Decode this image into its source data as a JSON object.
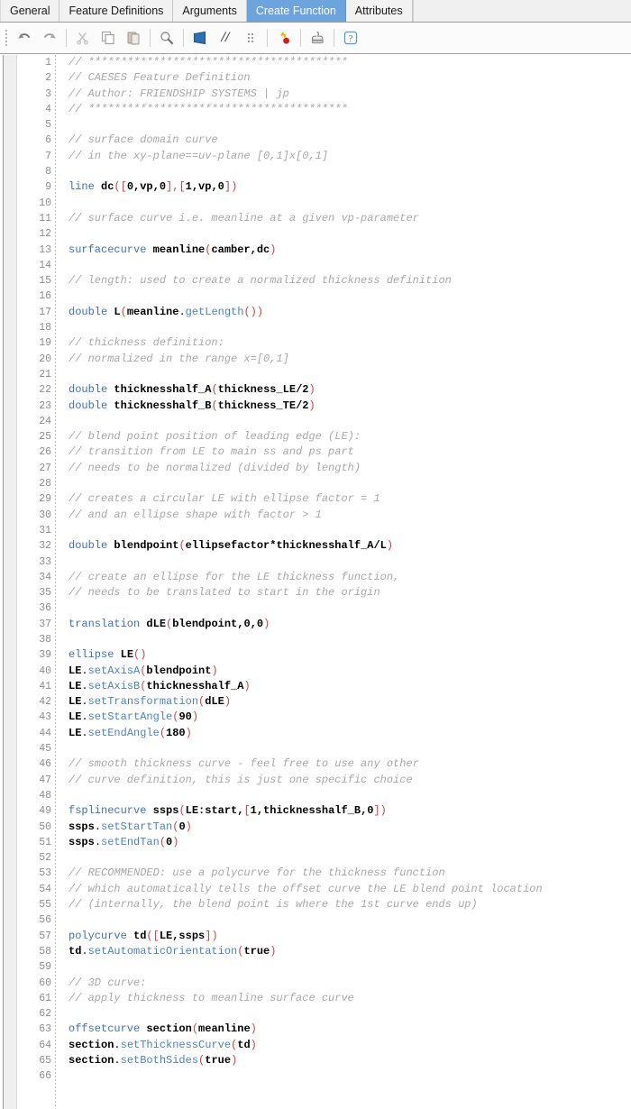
{
  "window": {
    "tabs": [
      {
        "label": "General",
        "active": false
      },
      {
        "label": "Feature Definitions",
        "active": false
      },
      {
        "label": "Arguments",
        "active": false
      },
      {
        "label": "Create Function",
        "active": true
      },
      {
        "label": "Attributes",
        "active": false
      }
    ],
    "active_tab": "Create Function"
  },
  "toolbar": {
    "buttons": [
      {
        "name": "undo-icon",
        "label": "Undo",
        "glyph": "arrow-undo"
      },
      {
        "name": "redo-icon",
        "label": "Redo",
        "glyph": "arrow-redo"
      },
      {
        "name": "cut-icon",
        "label": "Cut",
        "glyph": "scissors"
      },
      {
        "name": "copy-icon",
        "label": "Copy",
        "glyph": "copy"
      },
      {
        "name": "paste-icon",
        "label": "Paste",
        "glyph": "clipboard"
      },
      {
        "name": "find-icon",
        "label": "Find",
        "glyph": "magnifier"
      },
      {
        "name": "insert-feature-icon",
        "label": "Insert Feature",
        "glyph": "blue-flag"
      },
      {
        "name": "comment-icon",
        "label": "Comment",
        "text": "//"
      },
      {
        "name": "indent-icon",
        "label": "Format",
        "glyph": "dots"
      },
      {
        "name": "run-icon",
        "label": "Run",
        "glyph": "star-dot"
      },
      {
        "name": "stamp-icon",
        "label": "Stamp",
        "glyph": "stamp"
      },
      {
        "name": "help-icon",
        "label": "Help",
        "text": "?"
      }
    ]
  },
  "colors": {
    "accent_blue": "#6da4de",
    "keyword_blue": "#3f6fbe",
    "method_blue": "#4b82c8",
    "comment_gray": "#a8a8a8",
    "bracket_red": "#cc4444",
    "gutter_gray": "#8d8d8d",
    "star_gold": "#e8b500",
    "dot_red": "#d81b1b"
  },
  "editor": {
    "first_line": 1,
    "last_line": 66,
    "lines": [
      {
        "n": 1,
        "tokens": [
          {
            "t": "c",
            "v": "// ****************************************"
          }
        ]
      },
      {
        "n": 2,
        "tokens": [
          {
            "t": "c",
            "v": "// CAESES Feature Definition"
          }
        ]
      },
      {
        "n": 3,
        "tokens": [
          {
            "t": "c",
            "v": "// Author: FRIENDSHIP SYSTEMS | jp"
          }
        ]
      },
      {
        "n": 4,
        "tokens": [
          {
            "t": "c",
            "v": "// ****************************************"
          }
        ]
      },
      {
        "n": 5,
        "tokens": []
      },
      {
        "n": 6,
        "tokens": [
          {
            "t": "c",
            "v": "// surface domain curve"
          }
        ]
      },
      {
        "n": 7,
        "tokens": [
          {
            "t": "c",
            "v": "// in the xy-plane==uv-plane [0,1]x[0,1]"
          }
        ]
      },
      {
        "n": 8,
        "tokens": []
      },
      {
        "n": 9,
        "tokens": [
          {
            "t": "k",
            "v": "line"
          },
          {
            "t": "n",
            "v": " "
          },
          {
            "t": "id",
            "v": "dc"
          },
          {
            "t": "p",
            "v": "(["
          },
          {
            "t": "id",
            "v": "0,vp,0"
          },
          {
            "t": "p",
            "v": "],["
          },
          {
            "t": "id",
            "v": "1,vp,0"
          },
          {
            "t": "p",
            "v": "])"
          }
        ]
      },
      {
        "n": 10,
        "tokens": []
      },
      {
        "n": 11,
        "tokens": [
          {
            "t": "c",
            "v": "// surface curve i.e. meanline at a given vp-parameter"
          }
        ]
      },
      {
        "n": 12,
        "tokens": []
      },
      {
        "n": 13,
        "tokens": [
          {
            "t": "k",
            "v": "surfacecurve"
          },
          {
            "t": "n",
            "v": " "
          },
          {
            "t": "id",
            "v": "meanline"
          },
          {
            "t": "p",
            "v": "("
          },
          {
            "t": "id",
            "v": "camber,dc"
          },
          {
            "t": "p",
            "v": ")"
          }
        ]
      },
      {
        "n": 14,
        "tokens": []
      },
      {
        "n": 15,
        "tokens": [
          {
            "t": "c",
            "v": "// length: used to create a normalized thickness definition"
          }
        ]
      },
      {
        "n": 16,
        "tokens": []
      },
      {
        "n": 17,
        "tokens": [
          {
            "t": "k",
            "v": "double"
          },
          {
            "t": "n",
            "v": " "
          },
          {
            "t": "id",
            "v": "L"
          },
          {
            "t": "p",
            "v": "("
          },
          {
            "t": "id",
            "v": "meanline"
          },
          {
            "t": "n",
            "v": "."
          },
          {
            "t": "m",
            "v": "getLength"
          },
          {
            "t": "p",
            "v": "())"
          }
        ]
      },
      {
        "n": 18,
        "tokens": []
      },
      {
        "n": 19,
        "tokens": [
          {
            "t": "c",
            "v": "// thickness definition:"
          }
        ]
      },
      {
        "n": 20,
        "tokens": [
          {
            "t": "c",
            "v": "// normalized in the range x=[0,1]"
          }
        ]
      },
      {
        "n": 21,
        "tokens": []
      },
      {
        "n": 22,
        "tokens": [
          {
            "t": "k",
            "v": "double"
          },
          {
            "t": "n",
            "v": " "
          },
          {
            "t": "id",
            "v": "thicknesshalf_A"
          },
          {
            "t": "p",
            "v": "("
          },
          {
            "t": "id",
            "v": "thickness_LE/2"
          },
          {
            "t": "p",
            "v": ")"
          }
        ]
      },
      {
        "n": 23,
        "tokens": [
          {
            "t": "k",
            "v": "double"
          },
          {
            "t": "n",
            "v": " "
          },
          {
            "t": "id",
            "v": "thicknesshalf_B"
          },
          {
            "t": "p",
            "v": "("
          },
          {
            "t": "id",
            "v": "thickness_TE/2"
          },
          {
            "t": "p",
            "v": ")"
          }
        ]
      },
      {
        "n": 24,
        "tokens": []
      },
      {
        "n": 25,
        "tokens": [
          {
            "t": "c",
            "v": "// blend point position of leading edge (LE):"
          }
        ]
      },
      {
        "n": 26,
        "tokens": [
          {
            "t": "c",
            "v": "// transition from LE to main ss and ps part"
          }
        ]
      },
      {
        "n": 27,
        "tokens": [
          {
            "t": "c",
            "v": "// needs to be normalized (divided by length)"
          }
        ]
      },
      {
        "n": 28,
        "tokens": []
      },
      {
        "n": 29,
        "tokens": [
          {
            "t": "c",
            "v": "// creates a circular LE with ellipse factor = 1"
          }
        ]
      },
      {
        "n": 30,
        "tokens": [
          {
            "t": "c",
            "v": "// and an ellipse shape with factor > 1"
          }
        ]
      },
      {
        "n": 31,
        "tokens": []
      },
      {
        "n": 32,
        "tokens": [
          {
            "t": "k",
            "v": "double"
          },
          {
            "t": "n",
            "v": " "
          },
          {
            "t": "id",
            "v": "blendpoint"
          },
          {
            "t": "p",
            "v": "("
          },
          {
            "t": "id",
            "v": "ellipsefactor*thicknesshalf_A/L"
          },
          {
            "t": "p",
            "v": ")"
          }
        ]
      },
      {
        "n": 33,
        "tokens": []
      },
      {
        "n": 34,
        "tokens": [
          {
            "t": "c",
            "v": "// create an ellipse for the LE thickness function,"
          }
        ]
      },
      {
        "n": 35,
        "tokens": [
          {
            "t": "c",
            "v": "// needs to be translated to start in the origin"
          }
        ]
      },
      {
        "n": 36,
        "tokens": []
      },
      {
        "n": 37,
        "tokens": [
          {
            "t": "k",
            "v": "translation"
          },
          {
            "t": "n",
            "v": " "
          },
          {
            "t": "id",
            "v": "dLE"
          },
          {
            "t": "p",
            "v": "("
          },
          {
            "t": "id",
            "v": "blendpoint,0,0"
          },
          {
            "t": "p",
            "v": ")"
          }
        ]
      },
      {
        "n": 38,
        "tokens": []
      },
      {
        "n": 39,
        "tokens": [
          {
            "t": "k",
            "v": "ellipse"
          },
          {
            "t": "n",
            "v": " "
          },
          {
            "t": "id",
            "v": "LE"
          },
          {
            "t": "p",
            "v": "()"
          }
        ]
      },
      {
        "n": 40,
        "tokens": [
          {
            "t": "id",
            "v": "LE"
          },
          {
            "t": "n",
            "v": "."
          },
          {
            "t": "m",
            "v": "setAxisA"
          },
          {
            "t": "p",
            "v": "("
          },
          {
            "t": "id",
            "v": "blendpoint"
          },
          {
            "t": "p",
            "v": ")"
          }
        ]
      },
      {
        "n": 41,
        "tokens": [
          {
            "t": "id",
            "v": "LE"
          },
          {
            "t": "n",
            "v": "."
          },
          {
            "t": "m",
            "v": "setAxisB"
          },
          {
            "t": "p",
            "v": "("
          },
          {
            "t": "id",
            "v": "thicknesshalf_A"
          },
          {
            "t": "p",
            "v": ")"
          }
        ]
      },
      {
        "n": 42,
        "tokens": [
          {
            "t": "id",
            "v": "LE"
          },
          {
            "t": "n",
            "v": "."
          },
          {
            "t": "m",
            "v": "setTransformation"
          },
          {
            "t": "p",
            "v": "("
          },
          {
            "t": "id",
            "v": "dLE"
          },
          {
            "t": "p",
            "v": ")"
          }
        ]
      },
      {
        "n": 43,
        "tokens": [
          {
            "t": "id",
            "v": "LE"
          },
          {
            "t": "n",
            "v": "."
          },
          {
            "t": "m",
            "v": "setStartAngle"
          },
          {
            "t": "p",
            "v": "("
          },
          {
            "t": "id",
            "v": "90"
          },
          {
            "t": "p",
            "v": ")"
          }
        ]
      },
      {
        "n": 44,
        "tokens": [
          {
            "t": "id",
            "v": "LE"
          },
          {
            "t": "n",
            "v": "."
          },
          {
            "t": "m",
            "v": "setEndAngle"
          },
          {
            "t": "p",
            "v": "("
          },
          {
            "t": "id",
            "v": "180"
          },
          {
            "t": "p",
            "v": ")"
          }
        ]
      },
      {
        "n": 45,
        "tokens": []
      },
      {
        "n": 46,
        "tokens": [
          {
            "t": "c",
            "v": "// smooth thickness curve - feel free to use any other"
          }
        ]
      },
      {
        "n": 47,
        "tokens": [
          {
            "t": "c",
            "v": "// curve definition, this is just one specific choice"
          }
        ]
      },
      {
        "n": 48,
        "tokens": []
      },
      {
        "n": 49,
        "tokens": [
          {
            "t": "k",
            "v": "fsplinecurve"
          },
          {
            "t": "n",
            "v": " "
          },
          {
            "t": "id",
            "v": "ssps"
          },
          {
            "t": "p",
            "v": "("
          },
          {
            "t": "id",
            "v": "LE:start,"
          },
          {
            "t": "p",
            "v": "["
          },
          {
            "t": "id",
            "v": "1,thicknesshalf_B,0"
          },
          {
            "t": "p",
            "v": "])"
          }
        ]
      },
      {
        "n": 50,
        "tokens": [
          {
            "t": "id",
            "v": "ssps"
          },
          {
            "t": "n",
            "v": "."
          },
          {
            "t": "m",
            "v": "setStartTan"
          },
          {
            "t": "p",
            "v": "("
          },
          {
            "t": "id",
            "v": "0"
          },
          {
            "t": "p",
            "v": ")"
          }
        ]
      },
      {
        "n": 51,
        "tokens": [
          {
            "t": "id",
            "v": "ssps"
          },
          {
            "t": "n",
            "v": "."
          },
          {
            "t": "m",
            "v": "setEndTan"
          },
          {
            "t": "p",
            "v": "("
          },
          {
            "t": "id",
            "v": "0"
          },
          {
            "t": "p",
            "v": ")"
          }
        ]
      },
      {
        "n": 52,
        "tokens": []
      },
      {
        "n": 53,
        "tokens": [
          {
            "t": "c",
            "v": "// RECOMMENDED: use a polycurve for the thickness function"
          }
        ]
      },
      {
        "n": 54,
        "tokens": [
          {
            "t": "c",
            "v": "// which automatically tells the offset curve the LE blend point location"
          }
        ]
      },
      {
        "n": 55,
        "tokens": [
          {
            "t": "c",
            "v": "// (internally, the blend point is where the 1st curve ends up)"
          }
        ]
      },
      {
        "n": 56,
        "tokens": []
      },
      {
        "n": 57,
        "tokens": [
          {
            "t": "k",
            "v": "polycurve"
          },
          {
            "t": "n",
            "v": " "
          },
          {
            "t": "id",
            "v": "td"
          },
          {
            "t": "p",
            "v": "(["
          },
          {
            "t": "id",
            "v": "LE,ssps"
          },
          {
            "t": "p",
            "v": "])"
          }
        ]
      },
      {
        "n": 58,
        "tokens": [
          {
            "t": "id",
            "v": "td"
          },
          {
            "t": "n",
            "v": "."
          },
          {
            "t": "m",
            "v": "setAutomaticOrientation"
          },
          {
            "t": "p",
            "v": "("
          },
          {
            "t": "id",
            "v": "true"
          },
          {
            "t": "p",
            "v": ")"
          }
        ]
      },
      {
        "n": 59,
        "tokens": []
      },
      {
        "n": 60,
        "tokens": [
          {
            "t": "c",
            "v": "// 3D curve:"
          }
        ]
      },
      {
        "n": 61,
        "tokens": [
          {
            "t": "c",
            "v": "// apply thickness to meanline surface curve"
          }
        ]
      },
      {
        "n": 62,
        "tokens": []
      },
      {
        "n": 63,
        "tokens": [
          {
            "t": "k",
            "v": "offsetcurve"
          },
          {
            "t": "n",
            "v": " "
          },
          {
            "t": "id",
            "v": "section"
          },
          {
            "t": "p",
            "v": "("
          },
          {
            "t": "id",
            "v": "meanline"
          },
          {
            "t": "p",
            "v": ")"
          }
        ]
      },
      {
        "n": 64,
        "tokens": [
          {
            "t": "id",
            "v": "section"
          },
          {
            "t": "n",
            "v": "."
          },
          {
            "t": "m",
            "v": "setThicknessCurve"
          },
          {
            "t": "p",
            "v": "("
          },
          {
            "t": "id",
            "v": "td"
          },
          {
            "t": "p",
            "v": ")"
          }
        ]
      },
      {
        "n": 65,
        "tokens": [
          {
            "t": "id",
            "v": "section"
          },
          {
            "t": "n",
            "v": "."
          },
          {
            "t": "m",
            "v": "setBothSides"
          },
          {
            "t": "p",
            "v": "("
          },
          {
            "t": "id",
            "v": "true"
          },
          {
            "t": "p",
            "v": ")"
          }
        ]
      },
      {
        "n": 66,
        "tokens": []
      }
    ]
  }
}
